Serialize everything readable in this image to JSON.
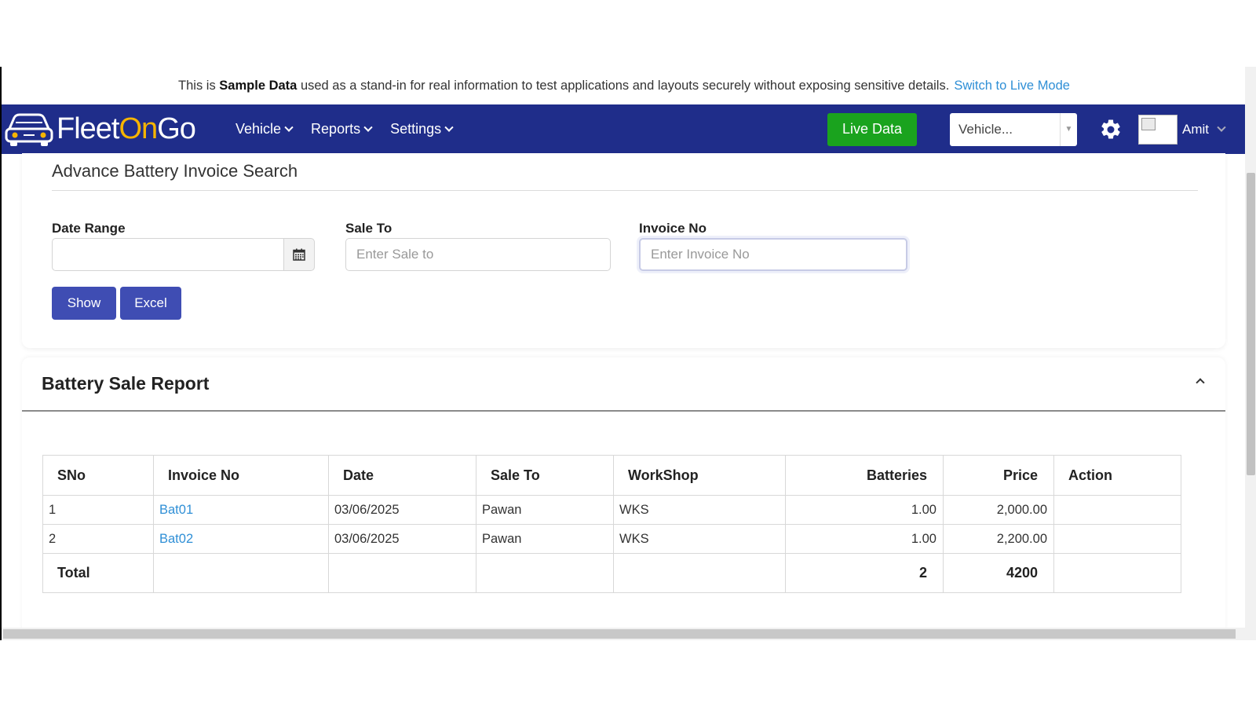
{
  "banner": {
    "prefix": "This is",
    "bold": "Sample Data",
    "suffix": "used as a stand-in for real information to test applications and layouts securely without exposing sensitive details.",
    "link": "Switch to Live Mode"
  },
  "navbar": {
    "logo_part1": "Fleet",
    "logo_part2": "On",
    "logo_part3": "Go",
    "menus": [
      "Vehicle",
      "Reports",
      "Settings"
    ],
    "live_button": "Live Data",
    "vehicle_select": "Vehicle...",
    "user": "Amit"
  },
  "search": {
    "title": "Advance Battery Invoice Search",
    "date_label": "Date Range",
    "date_value": "",
    "sale_label": "Sale To",
    "sale_placeholder": "Enter Sale to",
    "invoice_label": "Invoice No",
    "invoice_placeholder": "Enter Invoice No",
    "show_button": "Show",
    "excel_button": "Excel"
  },
  "report": {
    "title": "Battery Sale Report",
    "columns": [
      "SNo",
      "Invoice No",
      "Date",
      "Sale To",
      "WorkShop",
      "Batteries",
      "Price",
      "Action"
    ],
    "rows": [
      {
        "sno": "1",
        "invoice": "Bat01",
        "date": "03/06/2025",
        "sale_to": "Pawan",
        "workshop": "WKS",
        "batteries": "1.00",
        "price": "2,000.00",
        "action": ""
      },
      {
        "sno": "2",
        "invoice": "Bat02",
        "date": "03/06/2025",
        "sale_to": "Pawan",
        "workshop": "WKS",
        "batteries": "1.00",
        "price": "2,200.00",
        "action": ""
      }
    ],
    "total": {
      "label": "Total",
      "batteries": "2",
      "price": "4200"
    }
  },
  "icons": {
    "calendar": "calendar-icon",
    "gear": "gear-icon",
    "collapse": "chevron-up-icon",
    "logo": "car-icon"
  },
  "colors": {
    "navbar": "#1f2d8a",
    "live_button": "#1aa31e",
    "primary_button": "#3f4db3",
    "link": "#2f8fd6",
    "logo_accent": "#f5b400"
  }
}
